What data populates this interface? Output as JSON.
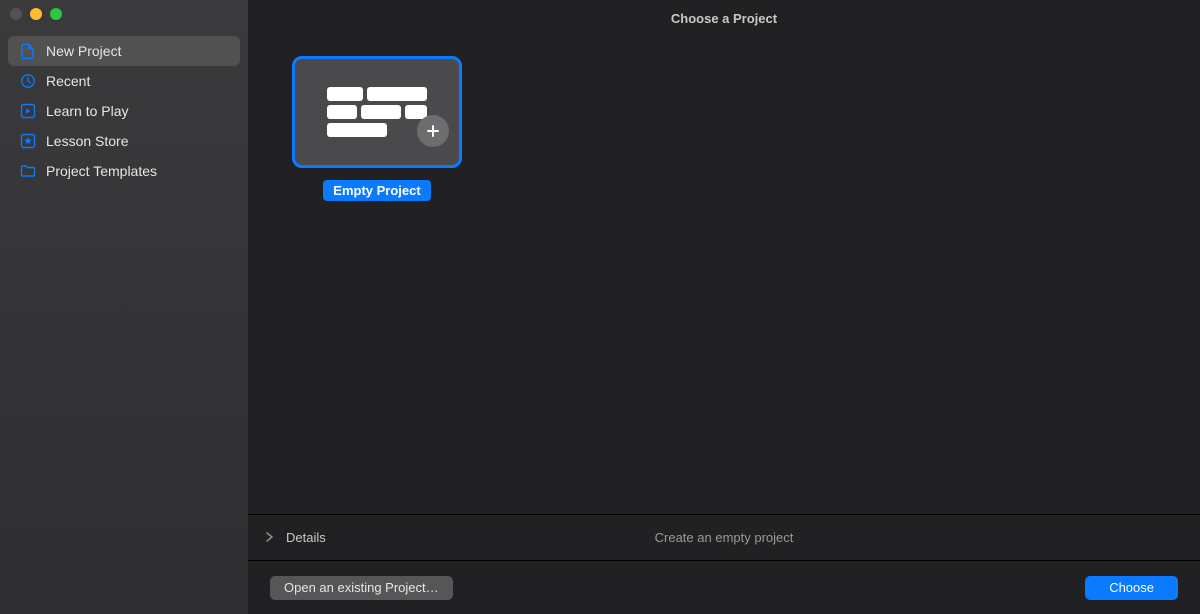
{
  "header": {
    "title": "Choose a Project"
  },
  "sidebar": {
    "items": [
      {
        "label": "New Project",
        "icon": "file-icon",
        "selected": true
      },
      {
        "label": "Recent",
        "icon": "clock-icon",
        "selected": false
      },
      {
        "label": "Learn to Play",
        "icon": "play-square-icon",
        "selected": false
      },
      {
        "label": "Lesson Store",
        "icon": "star-square-icon",
        "selected": false
      },
      {
        "label": "Project Templates",
        "icon": "folder-icon",
        "selected": false
      }
    ]
  },
  "templates": [
    {
      "label": "Empty Project",
      "selected": true
    }
  ],
  "details": {
    "title": "Details",
    "description": "Create an empty project"
  },
  "footer": {
    "open_existing_label": "Open an existing Project…",
    "choose_label": "Choose"
  },
  "colors": {
    "accent": "#0a7aff"
  }
}
